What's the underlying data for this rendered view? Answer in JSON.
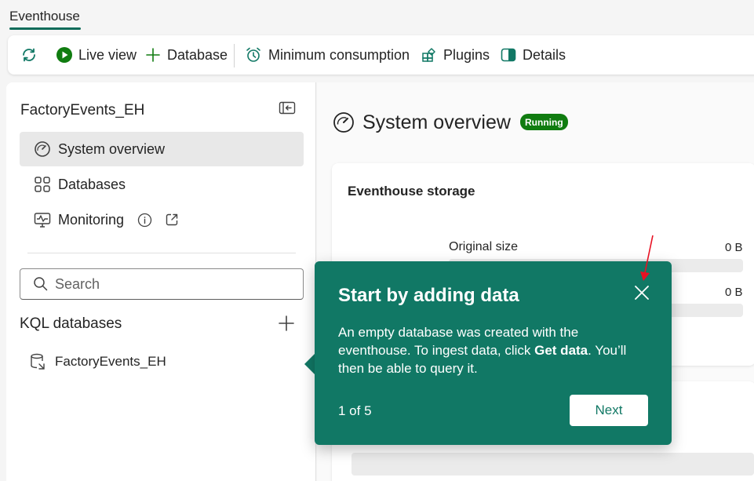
{
  "tab": {
    "label": "Eventhouse"
  },
  "toolbar": {
    "refresh_icon": "refresh-icon",
    "live_view": "Live view",
    "database": "Database",
    "minimum_consumption": "Minimum consumption",
    "plugins": "Plugins",
    "details": "Details"
  },
  "sidebar": {
    "title": "FactoryEvents_EH",
    "nav": [
      {
        "label": "System overview",
        "icon": "gauge-icon",
        "selected": true
      },
      {
        "label": "Databases",
        "icon": "grid-icon"
      },
      {
        "label": "Monitoring",
        "icon": "monitor-icon"
      }
    ],
    "search_placeholder": "Search",
    "kql_header": "KQL databases",
    "databases": [
      {
        "label": "FactoryEvents_EH"
      }
    ]
  },
  "main": {
    "title": "System overview",
    "status_badge": "Running",
    "storage_card": {
      "title": "Eventhouse storage",
      "original_size_label": "Original size",
      "original_size_value": "0 B",
      "second_value": "0 B"
    }
  },
  "popover": {
    "title": "Start by adding data",
    "body_pre": "An empty database was created with the eventhouse. To ingest data, click ",
    "body_bold": "Get data",
    "body_post": ". You’ll then be able to query it.",
    "step_count": "1 of 5",
    "next_label": "Next"
  },
  "colors": {
    "brand": "#117865",
    "badge": "#107c10",
    "live_icon": "#107c10"
  }
}
